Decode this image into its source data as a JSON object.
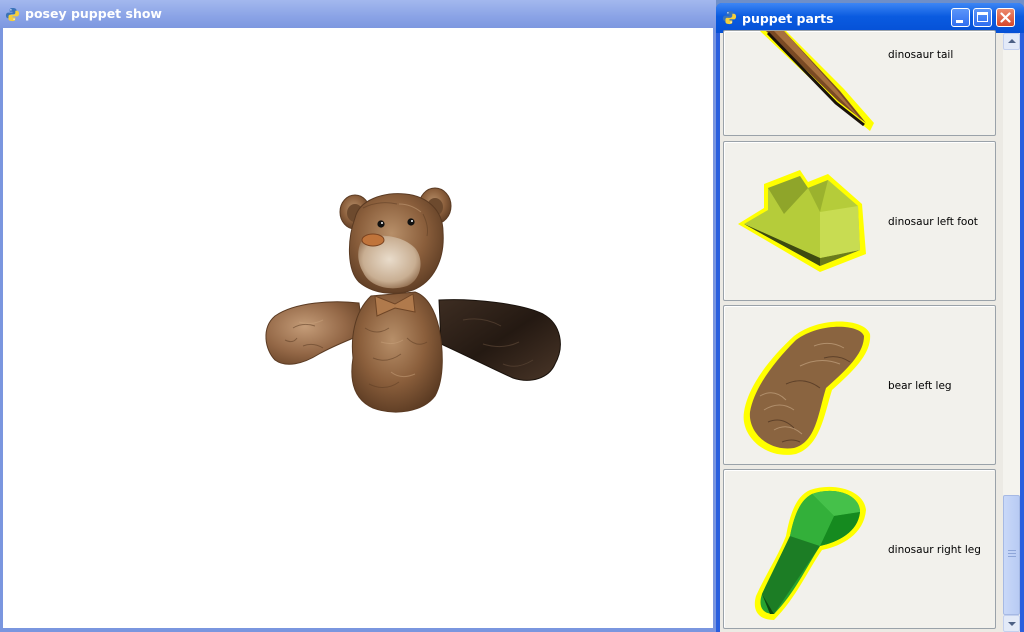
{
  "main_window": {
    "title": "posey puppet show",
    "icon": "python-icon"
  },
  "parts_window": {
    "title": "puppet parts",
    "icon": "python-icon",
    "buttons": [
      "minimize-button",
      "maximize-button",
      "close-button"
    ],
    "parts": [
      {
        "label": "dinosaur tail",
        "color": "#7a4a24"
      },
      {
        "label": "dinosaur left foot",
        "color": "#b5cc3a"
      },
      {
        "label": "bear left leg",
        "color": "#8a6440"
      },
      {
        "label": "dinosaur right leg",
        "color": "#27a331"
      }
    ],
    "highlight_color": "#ffff00"
  },
  "scene": {
    "subject": "teddy-bear-puppet",
    "fur_color": "#8b5f3c",
    "arm_dark_color": "#2e2118"
  }
}
